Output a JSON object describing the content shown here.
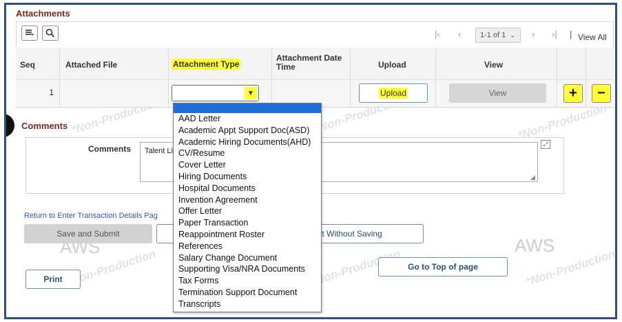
{
  "attachments": {
    "title": "Attachments",
    "pager": {
      "range": "1-1 of 1",
      "view_all": "View All"
    },
    "headers": {
      "seq": "Seq",
      "attached_file": "Attached File",
      "attachment_type": "Attachment Type",
      "attachment_date_time": "Attachment Date Time",
      "upload": "Upload",
      "view": "View"
    },
    "row": {
      "seq": "1",
      "upload_label": "Upload",
      "view_label": "View",
      "add_label": "+",
      "remove_label": "−"
    },
    "type_options": [
      "AAD Letter",
      "Academic Appt Support Doc(ASD)",
      "Academic Hiring Documents(AHD)",
      "CV/Resume",
      "Cover Letter",
      "Hiring Documents",
      "Hospital Documents",
      "Invention Agreement",
      "Offer Letter",
      "Paper Transaction",
      "Reappointment Roster",
      "References",
      "Salary Change Document",
      "Supporting Visa/NRA Documents",
      "Tax Forms",
      "Termination Support Document",
      "Transcripts"
    ]
  },
  "comments": {
    "title": "Comments",
    "label": "Comments",
    "value": "Talent Li"
  },
  "actions": {
    "return_link": "Return to Enter Transaction Details Pag",
    "save_submit": "Save and Submit",
    "exit_without_saving": "uit Without Saving",
    "go_to_top": "Go to Top of page",
    "print": "Print"
  },
  "watermarks": {
    "non_production": "*Non-Production",
    "aws": "AWS"
  },
  "colors": {
    "highlight": "#ffff33",
    "section_title": "#7a2a1a",
    "frame": "#2f4f7f",
    "selected_option": "#1f6fd9"
  }
}
